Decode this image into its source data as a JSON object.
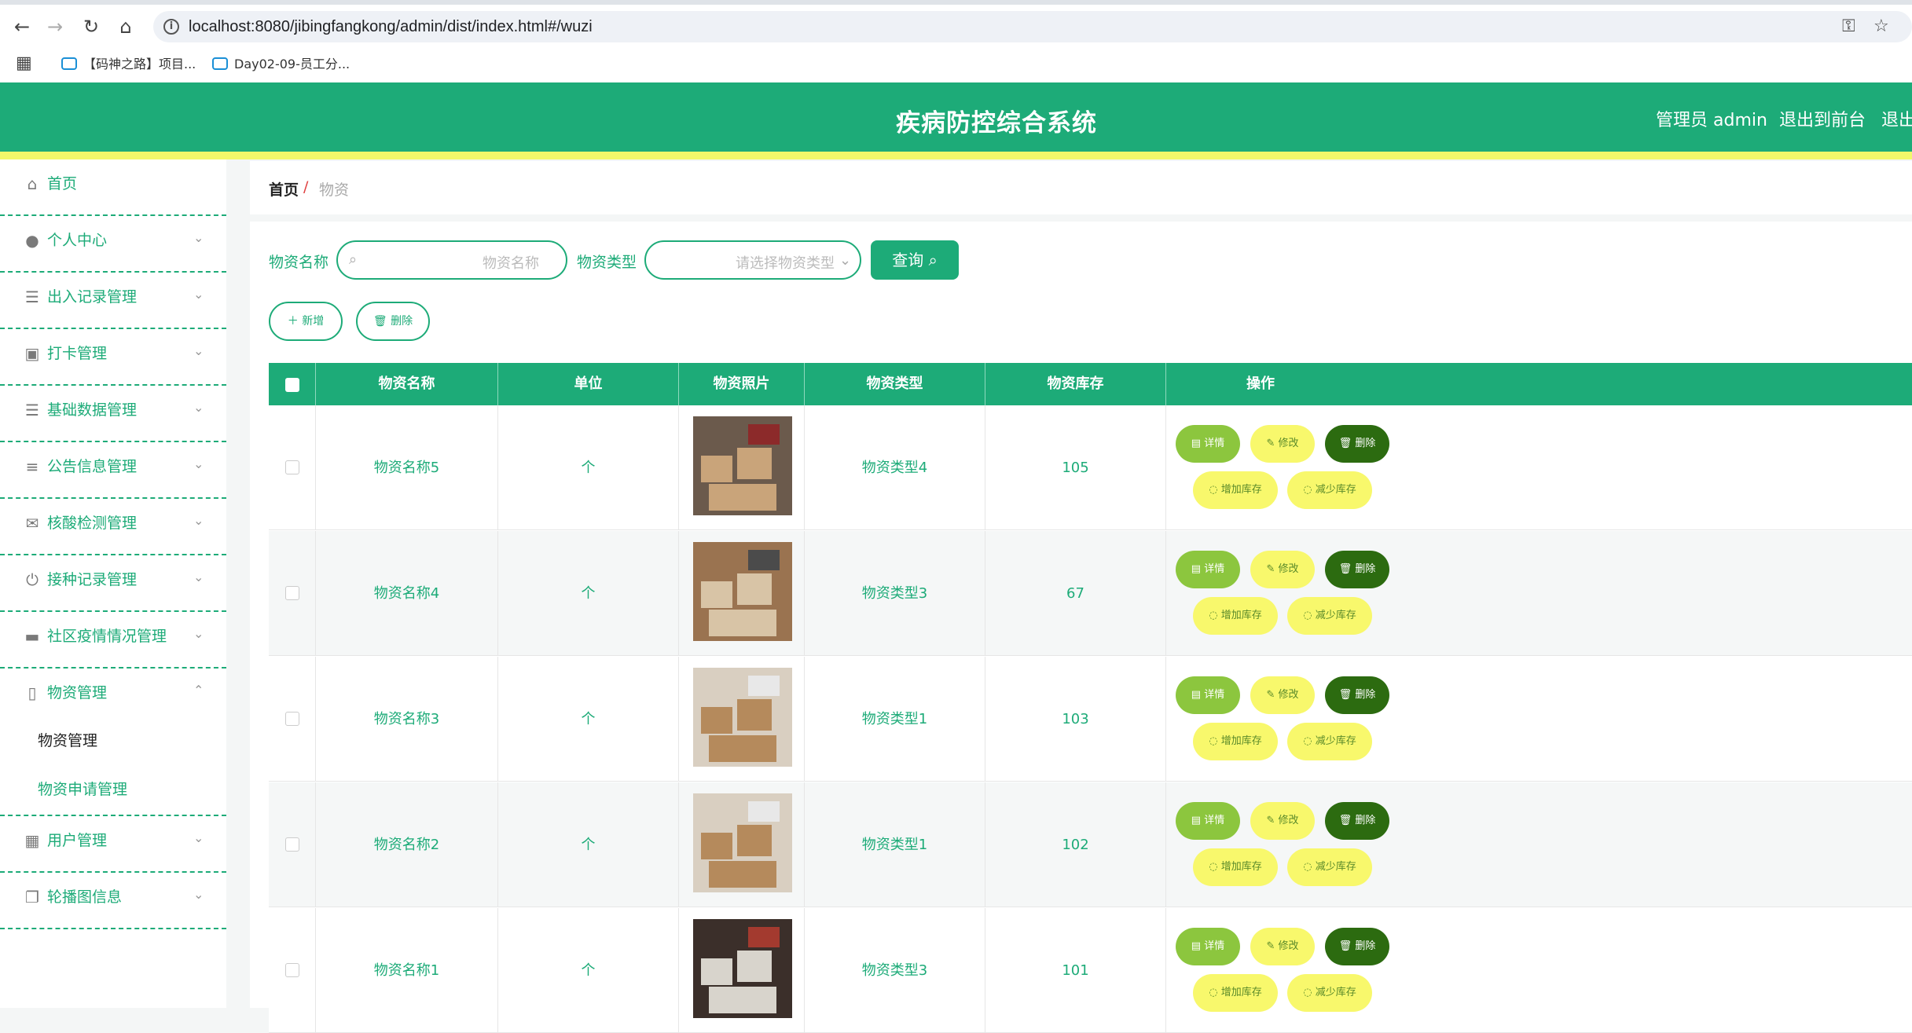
{
  "browser": {
    "url": "localhost:8080/jibingfangkong/admin/dist/index.html#/wuzi",
    "bookmarks": [
      "【码神之路】项目...",
      "Day02-09-员工分..."
    ]
  },
  "header": {
    "title": "疾病防控综合系统",
    "user_label": "管理员 admin",
    "to_front_label": "退出到前台",
    "logout_label": "退出"
  },
  "sidebar": {
    "items": [
      {
        "label": "首页",
        "icon": "home-icon"
      },
      {
        "label": "个人中心",
        "icon": "user-icon"
      },
      {
        "label": "出入记录管理",
        "icon": "list-icon"
      },
      {
        "label": "打卡管理",
        "icon": "clipboard-icon"
      },
      {
        "label": "基础数据管理",
        "icon": "list-icon"
      },
      {
        "label": "公告信息管理",
        "icon": "sliders-icon"
      },
      {
        "label": "核酸检测管理",
        "icon": "mail-icon"
      },
      {
        "label": "接种记录管理",
        "icon": "power-icon"
      },
      {
        "label": "社区疫情情况管理",
        "icon": "monitor-icon"
      },
      {
        "label": "物资管理",
        "icon": "bottle-icon"
      },
      {
        "label": "用户管理",
        "icon": "grid-icon"
      },
      {
        "label": "轮播图信息",
        "icon": "copy-icon"
      }
    ],
    "submenu": [
      "物资管理",
      "物资申请管理"
    ]
  },
  "breadcrumb": {
    "home": "首页",
    "separator": "/",
    "current": "物资"
  },
  "search": {
    "name_label": "物资名称",
    "name_placeholder": "物资名称",
    "type_label": "物资类型",
    "type_placeholder": "请选择物资类型",
    "query_label": "查询"
  },
  "toolbar": {
    "add_label": "新增",
    "delete_label": "删除"
  },
  "table": {
    "headers": [
      "物资名称",
      "单位",
      "物资照片",
      "物资类型",
      "物资库存",
      "操作"
    ],
    "rows": [
      {
        "name": "物资名称5",
        "unit": "个",
        "type": "物资类型4",
        "stock": "105"
      },
      {
        "name": "物资名称4",
        "unit": "个",
        "type": "物资类型3",
        "stock": "67"
      },
      {
        "name": "物资名称3",
        "unit": "个",
        "type": "物资类型1",
        "stock": "103"
      },
      {
        "name": "物资名称2",
        "unit": "个",
        "type": "物资类型1",
        "stock": "102"
      },
      {
        "name": "物资名称1",
        "unit": "个",
        "type": "物资类型3",
        "stock": "101"
      }
    ],
    "actions": {
      "detail": "详情",
      "edit": "修改",
      "delete": "删除",
      "add_stock": "增加库存",
      "reduce_stock": "减少库存"
    }
  },
  "colors": {
    "primary": "#1dab78",
    "accent_yellow": "#f2f86a",
    "dark_green": "#2c6b10",
    "lime": "#8cc63e"
  }
}
